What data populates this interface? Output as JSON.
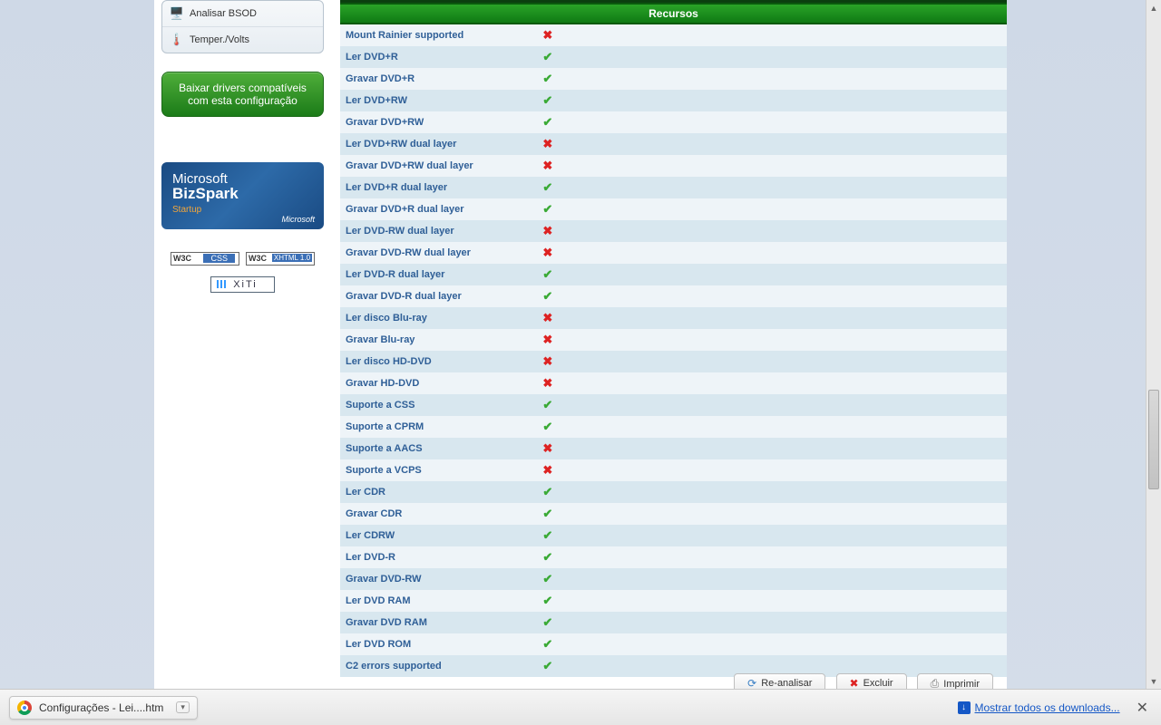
{
  "sidebar": {
    "menu": [
      {
        "icon": "🖥️",
        "label": "Analisar BSOD"
      },
      {
        "icon": "🌡️",
        "label": "Temper./Volts"
      }
    ],
    "green_button_l1": "Baixar drivers compatíveis",
    "green_button_l2": "com esta configuração",
    "bizspark": {
      "line1": "Microsoft",
      "line2": "BizSpark",
      "line3": "Startup",
      "corp": "Microsoft"
    },
    "xiti": "XiTi"
  },
  "table": {
    "header": "Recursos",
    "rows": [
      {
        "label": "Mount Rainier supported",
        "ok": false
      },
      {
        "label": "Ler DVD+R",
        "ok": true
      },
      {
        "label": "Gravar DVD+R",
        "ok": true
      },
      {
        "label": "Ler DVD+RW",
        "ok": true
      },
      {
        "label": "Gravar DVD+RW",
        "ok": true
      },
      {
        "label": "Ler DVD+RW dual layer",
        "ok": false
      },
      {
        "label": "Gravar DVD+RW dual layer",
        "ok": false
      },
      {
        "label": "Ler DVD+R dual layer",
        "ok": true
      },
      {
        "label": "Gravar DVD+R dual layer",
        "ok": true
      },
      {
        "label": "Ler DVD-RW dual layer",
        "ok": false
      },
      {
        "label": "Gravar DVD-RW dual layer",
        "ok": false
      },
      {
        "label": "Ler DVD-R dual layer",
        "ok": true
      },
      {
        "label": "Gravar DVD-R dual layer",
        "ok": true
      },
      {
        "label": "Ler disco Blu-ray",
        "ok": false
      },
      {
        "label": "Gravar Blu-ray",
        "ok": false
      },
      {
        "label": "Ler disco HD-DVD",
        "ok": false
      },
      {
        "label": "Gravar HD-DVD",
        "ok": false
      },
      {
        "label": "Suporte a CSS",
        "ok": true
      },
      {
        "label": "Suporte a CPRM",
        "ok": true
      },
      {
        "label": "Suporte a AACS",
        "ok": false
      },
      {
        "label": "Suporte a VCPS",
        "ok": false
      },
      {
        "label": "Ler CDR",
        "ok": true
      },
      {
        "label": "Gravar CDR",
        "ok": true
      },
      {
        "label": "Ler CDRW",
        "ok": true
      },
      {
        "label": "Ler DVD-R",
        "ok": true
      },
      {
        "label": "Gravar DVD-RW",
        "ok": true
      },
      {
        "label": "Ler DVD RAM",
        "ok": true
      },
      {
        "label": "Gravar DVD RAM",
        "ok": true
      },
      {
        "label": "Ler DVD ROM",
        "ok": true
      },
      {
        "label": "C2 errors supported",
        "ok": true
      }
    ]
  },
  "actions": {
    "reanalyze": "Re-analisar",
    "delete": "Excluir",
    "print": "Imprimir"
  },
  "browser": {
    "download_chip": "Configurações - Lei....htm",
    "show_all": "Mostrar todos os downloads..."
  }
}
